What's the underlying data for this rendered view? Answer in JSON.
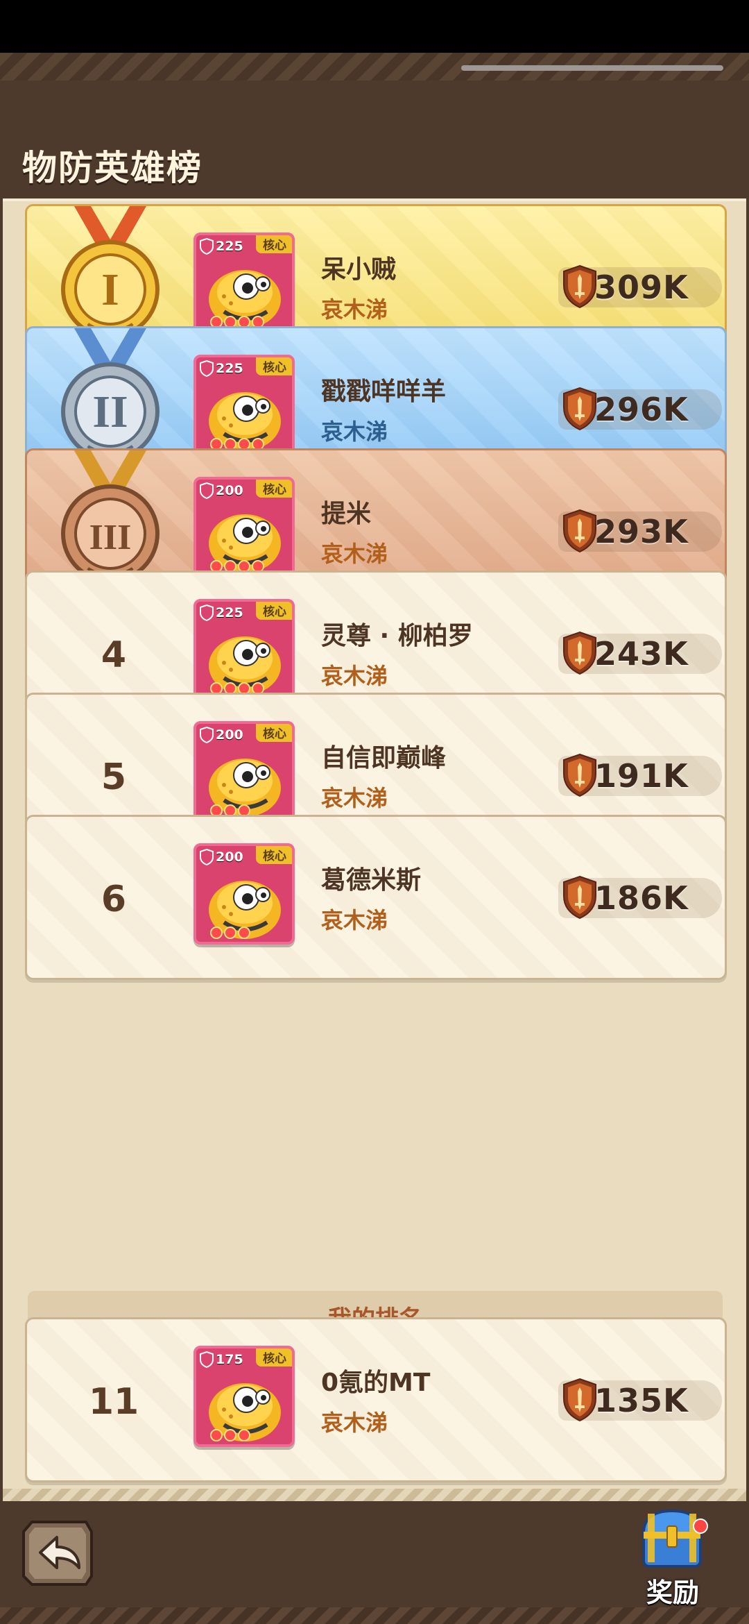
{
  "header": {
    "title": "物防英雄榜"
  },
  "rankings": [
    {
      "rank": "1",
      "tier": "gold",
      "level": "225",
      "core": "核心",
      "name": "呆小贼",
      "sub": "哀木涕",
      "stars": 4,
      "power": "309K"
    },
    {
      "rank": "2",
      "tier": "silver",
      "level": "225",
      "core": "核心",
      "name": "戳戳咩咩羊",
      "sub": "哀木涕",
      "stars": 4,
      "power": "296K"
    },
    {
      "rank": "3",
      "tier": "bronze",
      "level": "200",
      "core": "核心",
      "name": "提米",
      "sub": "哀木涕",
      "stars": 4,
      "power": "293K"
    },
    {
      "rank": "4",
      "tier": "plain",
      "level": "225",
      "core": "核心",
      "name": "灵尊 · 柳柏罗",
      "sub": "哀木涕",
      "stars": 4,
      "power": "243K"
    },
    {
      "rank": "5",
      "tier": "plain",
      "level": "200",
      "core": "核心",
      "name": "自信即巅峰",
      "sub": "哀木涕",
      "stars": 3,
      "power": "191K"
    },
    {
      "rank": "6",
      "tier": "plain",
      "level": "200",
      "core": "核心",
      "name": "葛德米斯",
      "sub": "哀木涕",
      "stars": 3,
      "power": "186K"
    }
  ],
  "my_rank": {
    "title": "我的排名",
    "entry": {
      "rank": "11",
      "level": "175",
      "core": "核心",
      "name": "0氪的MT",
      "sub": "哀木涕",
      "stars": 3,
      "power": "135K"
    }
  },
  "footer": {
    "reward_label": "奖励"
  },
  "icons": {
    "back": "back-arrow-icon",
    "reward": "treasure-chest-icon",
    "power": "shield-sword-icon",
    "gold_medal": "gold-medal-icon",
    "silver_medal": "silver-medal-icon",
    "bronze_medal": "bronze-medal-icon"
  },
  "colors": {
    "gold": "#f6dc6a",
    "silver": "#89c4f4",
    "bronze": "#e0a685",
    "plain": "#fbf3df",
    "accent_text": "#b25f1c"
  }
}
